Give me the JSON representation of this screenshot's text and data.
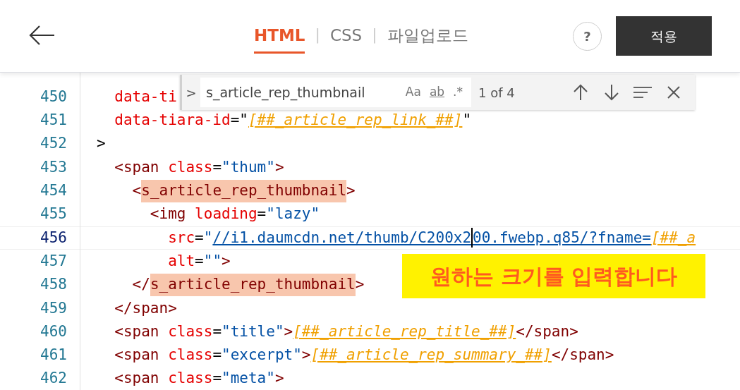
{
  "header": {
    "tabs": [
      {
        "label": "HTML",
        "selected": true
      },
      {
        "label": "CSS",
        "selected": false
      },
      {
        "label": "파일업로드",
        "selected": false
      }
    ],
    "separators": [
      "|",
      "|"
    ],
    "help": "?",
    "apply_button": "적용"
  },
  "find_widget": {
    "toggle": ">",
    "value": "s_article_rep_thumbnail",
    "options": [
      {
        "kind": "case",
        "label": "Aa"
      },
      {
        "kind": "word",
        "label": "ab"
      },
      {
        "kind": "regex",
        "label": ".*"
      }
    ],
    "result": "1 of 4"
  },
  "editor": {
    "lines": [
      {
        "number": "450",
        "current": false,
        "tokens": [
          {
            "kind": "attr",
            "text": "  data-ti"
          }
        ]
      },
      {
        "number": "451",
        "current": false,
        "tokens": [
          {
            "kind": "attr",
            "text": "  data-tiara-id"
          },
          {
            "kind": "punct",
            "text": "=\""
          },
          {
            "kind": "tpl",
            "text": "[##_article_rep_link_##]"
          },
          {
            "kind": "punct",
            "text": "\""
          }
        ]
      },
      {
        "number": "452",
        "current": false,
        "tokens": [
          {
            "kind": "punct",
            "text": ">"
          }
        ]
      },
      {
        "number": "453",
        "current": false,
        "tokens": [
          {
            "kind": "tag",
            "text": "  <span"
          },
          {
            "kind": "attr",
            "text": " class"
          },
          {
            "kind": "punct",
            "text": "="
          },
          {
            "kind": "str",
            "text": "\"thum\""
          },
          {
            "kind": "tag",
            "text": ">"
          }
        ]
      },
      {
        "number": "454",
        "current": false,
        "tokens": [
          {
            "kind": "tag",
            "text": "    <"
          },
          {
            "kind": "match",
            "text": "s_article_rep_thumbnail"
          },
          {
            "kind": "tag",
            "text": ">"
          }
        ]
      },
      {
        "number": "455",
        "current": false,
        "tokens": [
          {
            "kind": "tag",
            "text": "      <img"
          },
          {
            "kind": "attr",
            "text": " loading"
          },
          {
            "kind": "punct",
            "text": "="
          },
          {
            "kind": "str",
            "text": "\"lazy\""
          }
        ]
      },
      {
        "number": "456",
        "current": true,
        "tokens": [
          {
            "kind": "attr",
            "text": "        src"
          },
          {
            "kind": "punct",
            "text": "="
          },
          {
            "kind": "str",
            "text": "\""
          },
          {
            "kind": "link",
            "text": "//i1.daumcdn.net/thumb/C200x2"
          },
          {
            "kind": "cursor"
          },
          {
            "kind": "link",
            "text": "00.fwebp.q85/?fname="
          },
          {
            "kind": "tpl",
            "text": "[##_a"
          }
        ]
      },
      {
        "number": "457",
        "current": false,
        "tokens": [
          {
            "kind": "attr",
            "text": "        alt"
          },
          {
            "kind": "punct",
            "text": "="
          },
          {
            "kind": "str",
            "text": "\"\""
          },
          {
            "kind": "tag",
            "text": ">"
          }
        ]
      },
      {
        "number": "458",
        "current": false,
        "tokens": [
          {
            "kind": "tag",
            "text": "    </"
          },
          {
            "kind": "match",
            "text": "s_article_rep_thumbnail"
          },
          {
            "kind": "tag",
            "text": ">"
          }
        ]
      },
      {
        "number": "459",
        "current": false,
        "tokens": [
          {
            "kind": "tag",
            "text": "  </span>"
          }
        ]
      },
      {
        "number": "460",
        "current": false,
        "tokens": [
          {
            "kind": "tag",
            "text": "  <span"
          },
          {
            "kind": "attr",
            "text": " class"
          },
          {
            "kind": "punct",
            "text": "="
          },
          {
            "kind": "str",
            "text": "\"title\""
          },
          {
            "kind": "tag",
            "text": ">"
          },
          {
            "kind": "tpl",
            "text": "[##_article_rep_title_##]"
          },
          {
            "kind": "tag",
            "text": "</span>"
          }
        ]
      },
      {
        "number": "461",
        "current": false,
        "tokens": [
          {
            "kind": "tag",
            "text": "  <span"
          },
          {
            "kind": "attr",
            "text": " class"
          },
          {
            "kind": "punct",
            "text": "="
          },
          {
            "kind": "str",
            "text": "\"excerpt\""
          },
          {
            "kind": "tag",
            "text": ">"
          },
          {
            "kind": "tpl",
            "text": "[##_article_rep_summary_##]"
          },
          {
            "kind": "tag",
            "text": "</span>"
          }
        ]
      },
      {
        "number": "462",
        "current": false,
        "tokens": [
          {
            "kind": "tag",
            "text": "  <span"
          },
          {
            "kind": "attr",
            "text": " class"
          },
          {
            "kind": "punct",
            "text": "="
          },
          {
            "kind": "str",
            "text": "\"meta\""
          },
          {
            "kind": "tag",
            "text": ">"
          }
        ]
      }
    ]
  },
  "annotation": "원하는 크기를 입력합니다"
}
